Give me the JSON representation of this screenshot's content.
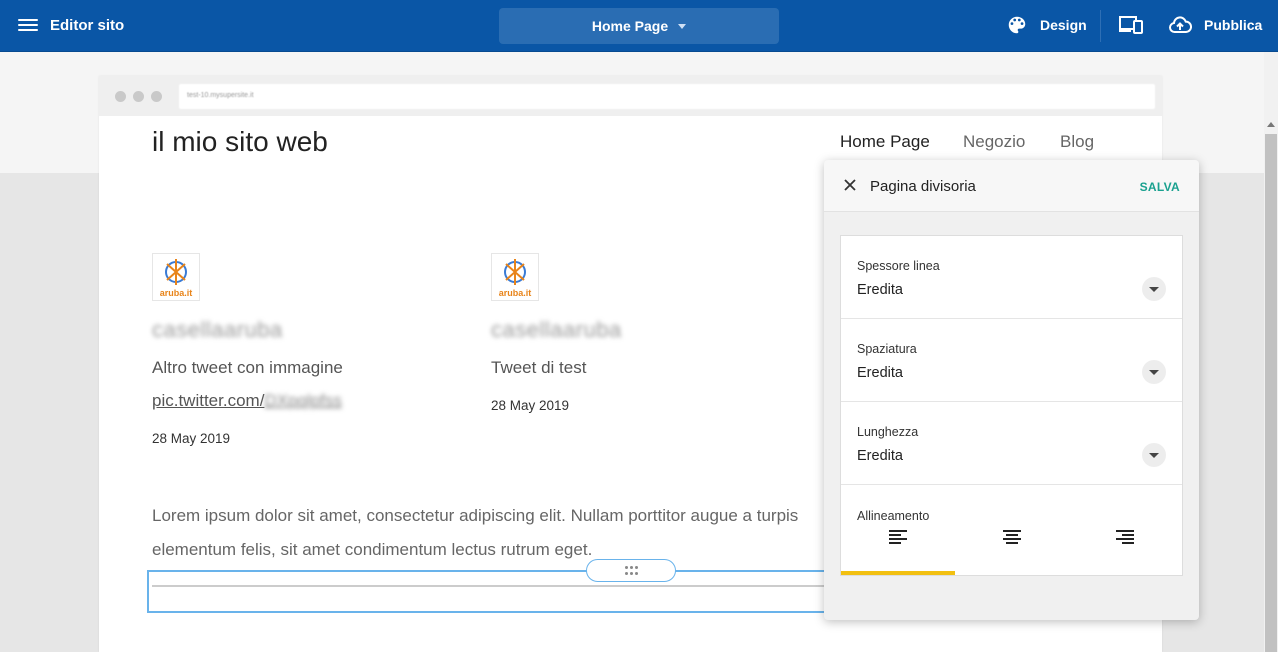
{
  "topbar": {
    "title": "Editor sito",
    "page_select": "Home Page",
    "design_label": "Design",
    "publish_label": "Pubblica"
  },
  "browser": {
    "url": "test-10.mysupersite.it"
  },
  "site": {
    "title": "il mio sito web",
    "nav": [
      "Home Page",
      "Negozio",
      "Blog"
    ]
  },
  "tweets": [
    {
      "logo_text": "aruba.it",
      "user": "casellaaruba",
      "text": "Altro tweet con immagine",
      "link_prefix": "pic.twitter.com/",
      "link_suffix": "DXpqlpfss",
      "date": "28 May 2019"
    },
    {
      "logo_text": "aruba.it",
      "user": "casellaaruba",
      "text": "Tweet di test",
      "date": "28 May 2019"
    }
  ],
  "lorem": {
    "line1": "Lorem ipsum dolor sit amet, consectetur adipiscing elit. Nullam porttitor augue a turpis",
    "line2": "elementum felis, sit amet condimentum lectus rutrum eget."
  },
  "panel": {
    "title": "Pagina divisoria",
    "save_label": "SALVA",
    "props": [
      {
        "label": "Spessore linea",
        "value": "Eredita"
      },
      {
        "label": "Spaziatura",
        "value": "Eredita"
      },
      {
        "label": "Lunghezza",
        "value": "Eredita"
      }
    ],
    "alignment_label": "Allineamento",
    "alignment_options": [
      "left",
      "center",
      "right"
    ],
    "alignment_selected": "left"
  },
  "colors": {
    "topbar": "#0a56a6",
    "accent_save": "#1aa18f",
    "selection": "#69b3eb",
    "active_tab": "#f2c011"
  }
}
